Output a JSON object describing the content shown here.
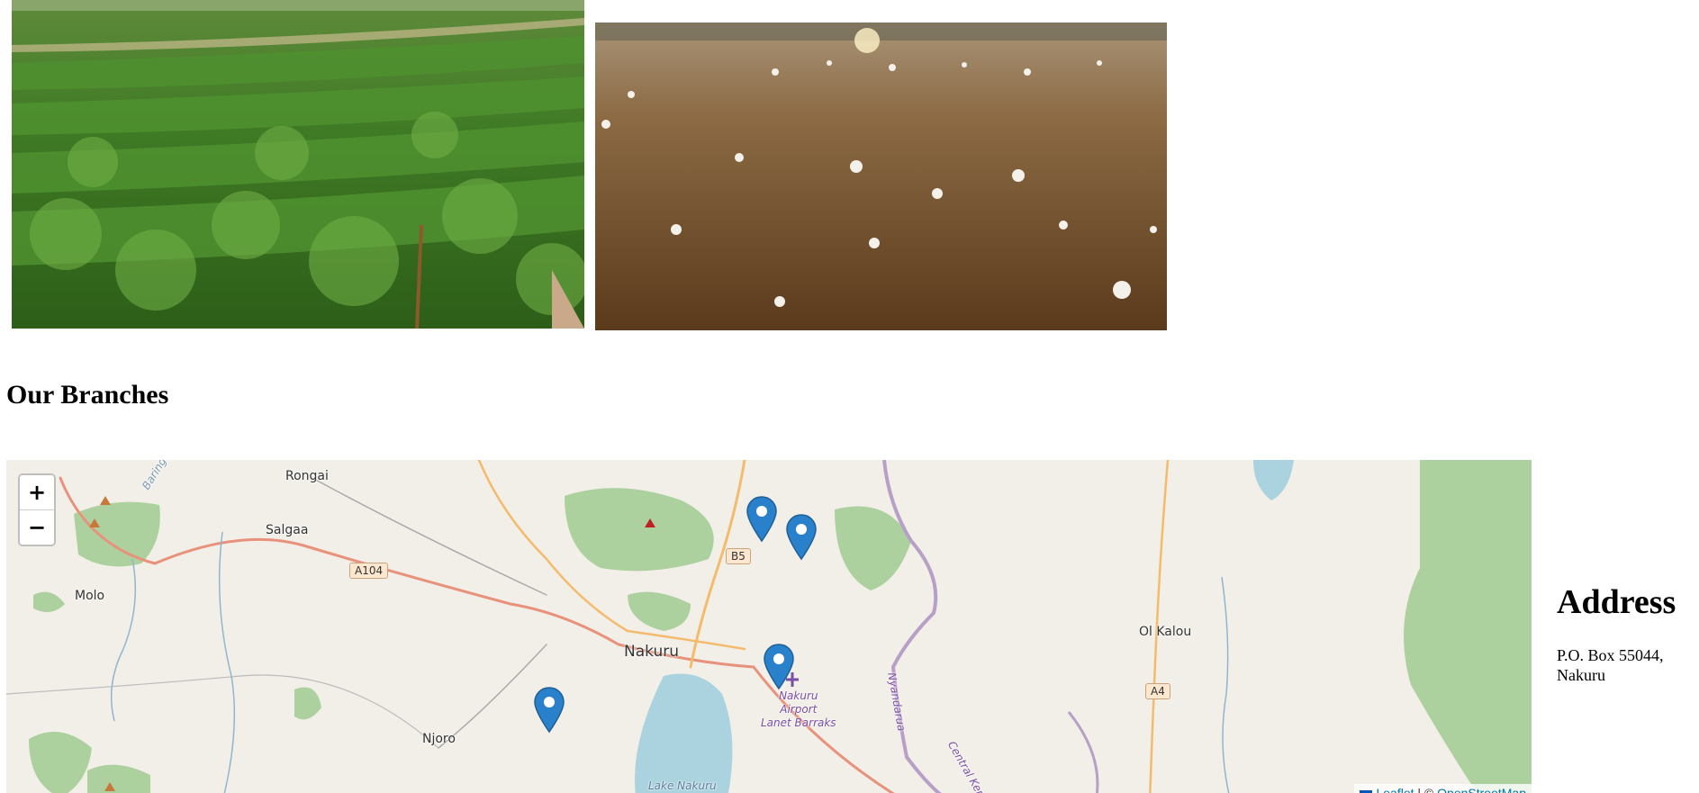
{
  "section": {
    "title": "Our Branches"
  },
  "map": {
    "zoom_in_label": "+",
    "zoom_out_label": "−",
    "places": {
      "rongai": "Rongai",
      "salgaa": "Salgaa",
      "molo": "Molo",
      "nakuru": "Nakuru",
      "njoro": "Njoro",
      "ol_kalou": "Ol Kalou",
      "lake_nakuru": "Lake Nakuru",
      "baringo": "Baringo",
      "nyandarua": "Nyandarua",
      "central_kenya": "Central Kenya",
      "airport_line1": "Nakuru",
      "airport_line2": "Airport",
      "airport_line3": "Lanet Barraks"
    },
    "roads": {
      "a104": "A104",
      "b5": "B5",
      "a4": "A4"
    },
    "marker_count": 4,
    "attribution": {
      "leaflet": "Leaflet",
      "separator": " | © ",
      "osm": "OpenStreetMap"
    },
    "colors": {
      "land": "#f2efe9",
      "forest": "#add19e",
      "water": "#aad3df",
      "marker": "#2a81cb"
    }
  },
  "address": {
    "title": "Address",
    "line1": "P.O. Box 55044,",
    "line2": "Nakuru"
  }
}
